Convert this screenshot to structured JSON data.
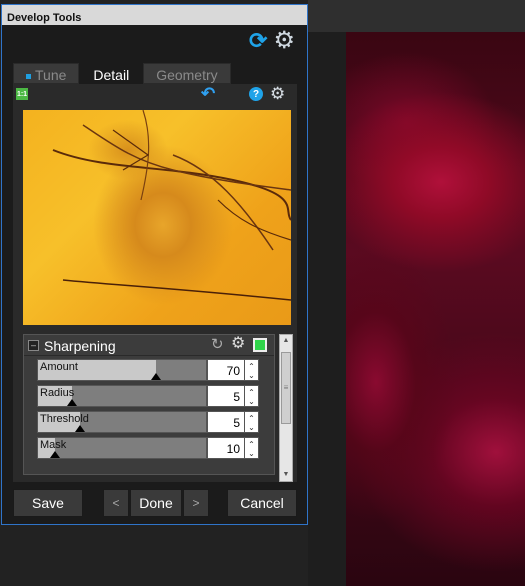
{
  "window": {
    "title": "Develop Tools"
  },
  "toolbar": {
    "refresh_icon": "refresh-icon",
    "settings_icon": "gear-icon"
  },
  "tabs": [
    {
      "label": "Tune",
      "active": false
    },
    {
      "label": "Detail",
      "active": true
    },
    {
      "label": "Geometry",
      "active": false
    }
  ],
  "content_tools": {
    "ratio_label": "1:1",
    "help_label": "?"
  },
  "sharpening": {
    "title": "Sharpening",
    "enabled": true,
    "sliders": [
      {
        "label": "Amount",
        "value": "70",
        "fraction": 0.7
      },
      {
        "label": "Radius",
        "value": "5",
        "fraction": 0.2
      },
      {
        "label": "Threshold",
        "value": "5",
        "fraction": 0.25
      },
      {
        "label": "Mask",
        "value": "10",
        "fraction": 0.1
      }
    ]
  },
  "footer": {
    "save_label": "Save",
    "prev_label": "<",
    "done_label": "Done",
    "next_label": ">",
    "cancel_label": "Cancel"
  },
  "colors": {
    "accent": "#1fa3e8",
    "enable": "#2fd44a",
    "panel_border": "#2f74c9"
  }
}
